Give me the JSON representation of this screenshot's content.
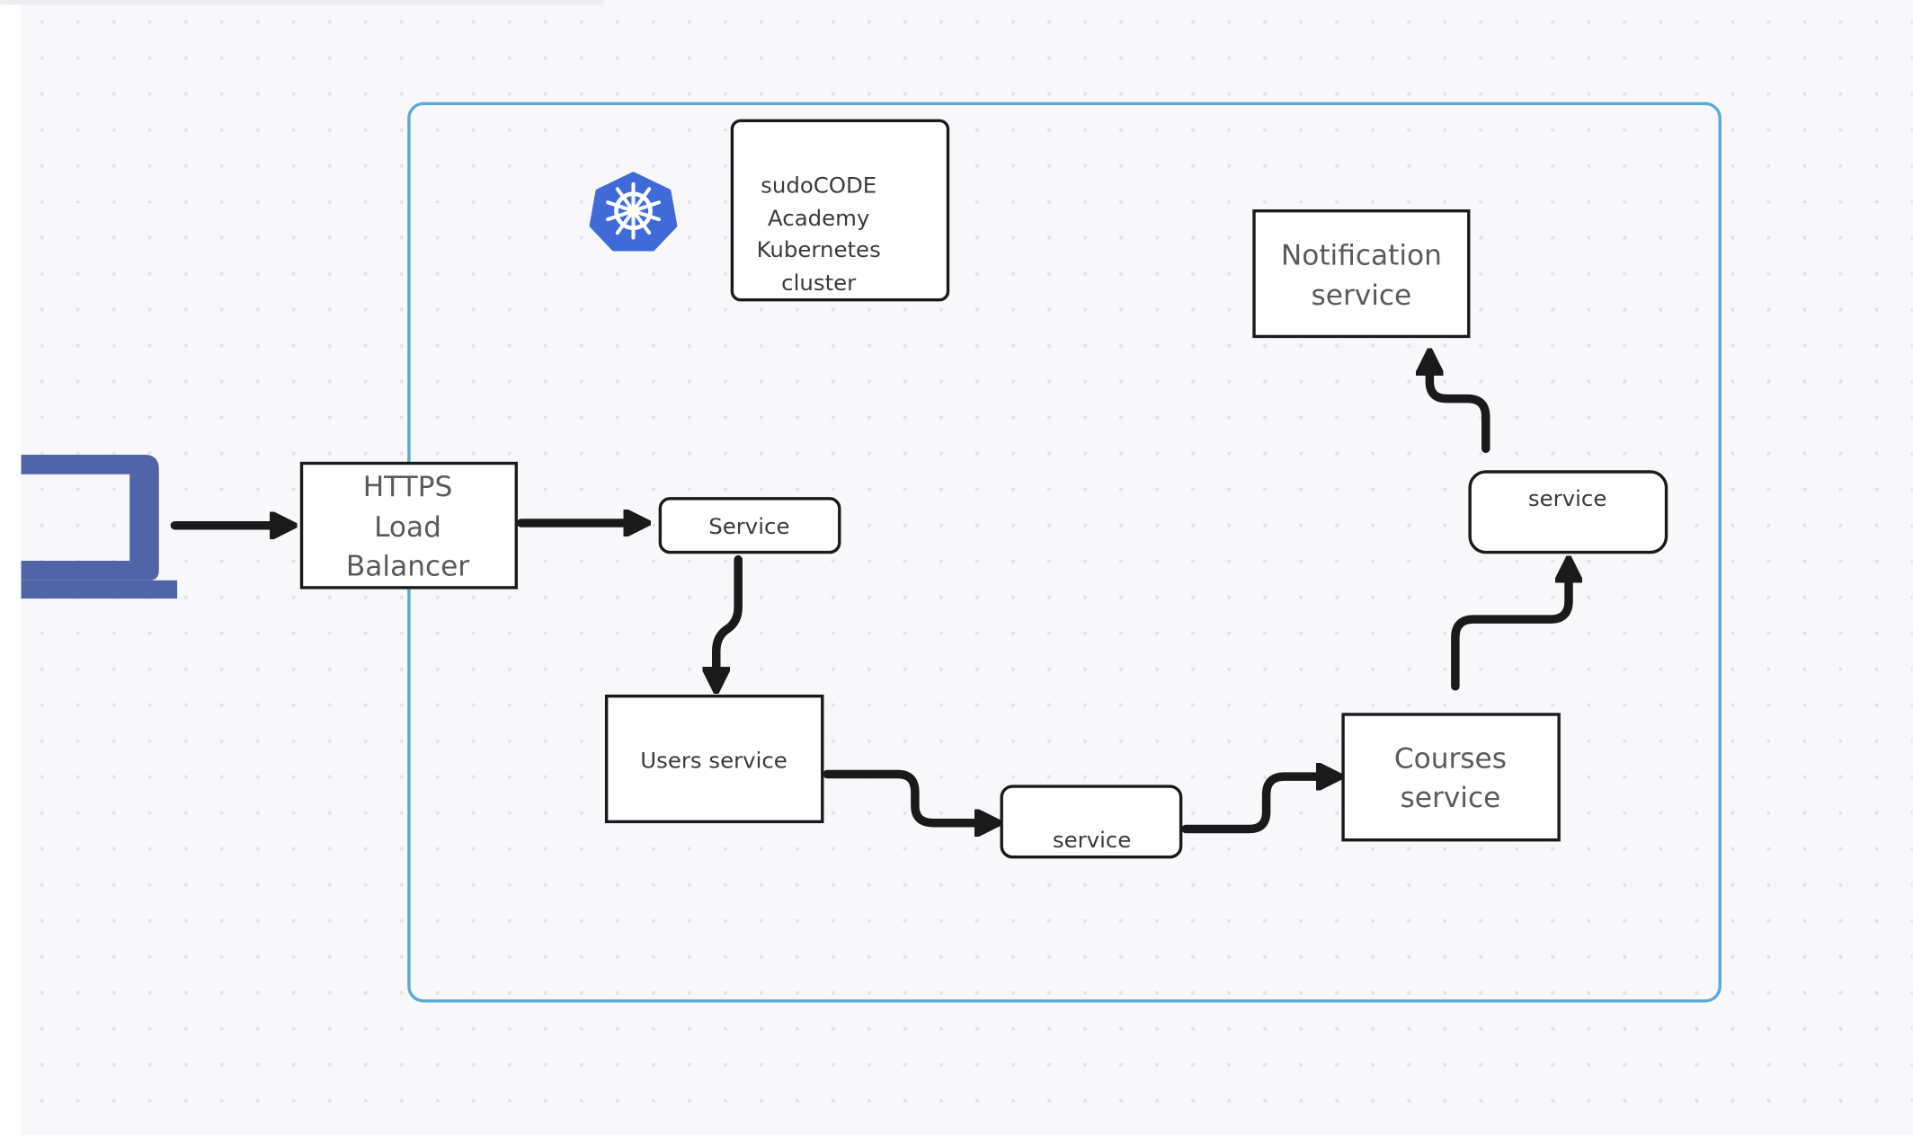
{
  "colors": {
    "cluster_border": "#5aa9d6",
    "kubernetes_logo": "#3f6ad8",
    "client_device": "#5064a8",
    "arrow": "#1a1a1a",
    "canvas": "#f8f8fb"
  },
  "icons": {
    "client": "laptop-icon",
    "cluster": "kubernetes-helm-icon"
  },
  "diagram": {
    "cluster_label": [
      "sudoCODE",
      "Academy",
      "Kubernetes",
      "cluster"
    ],
    "load_balancer": [
      "HTTPS",
      "Load",
      "Balancer"
    ],
    "service_entry": "Service",
    "users_service": "Users service",
    "service_users_to_courses": "service",
    "courses_service": [
      "Courses",
      "service"
    ],
    "service_courses_to_notification": "service",
    "notification_service": [
      "Notification",
      "service"
    ]
  }
}
